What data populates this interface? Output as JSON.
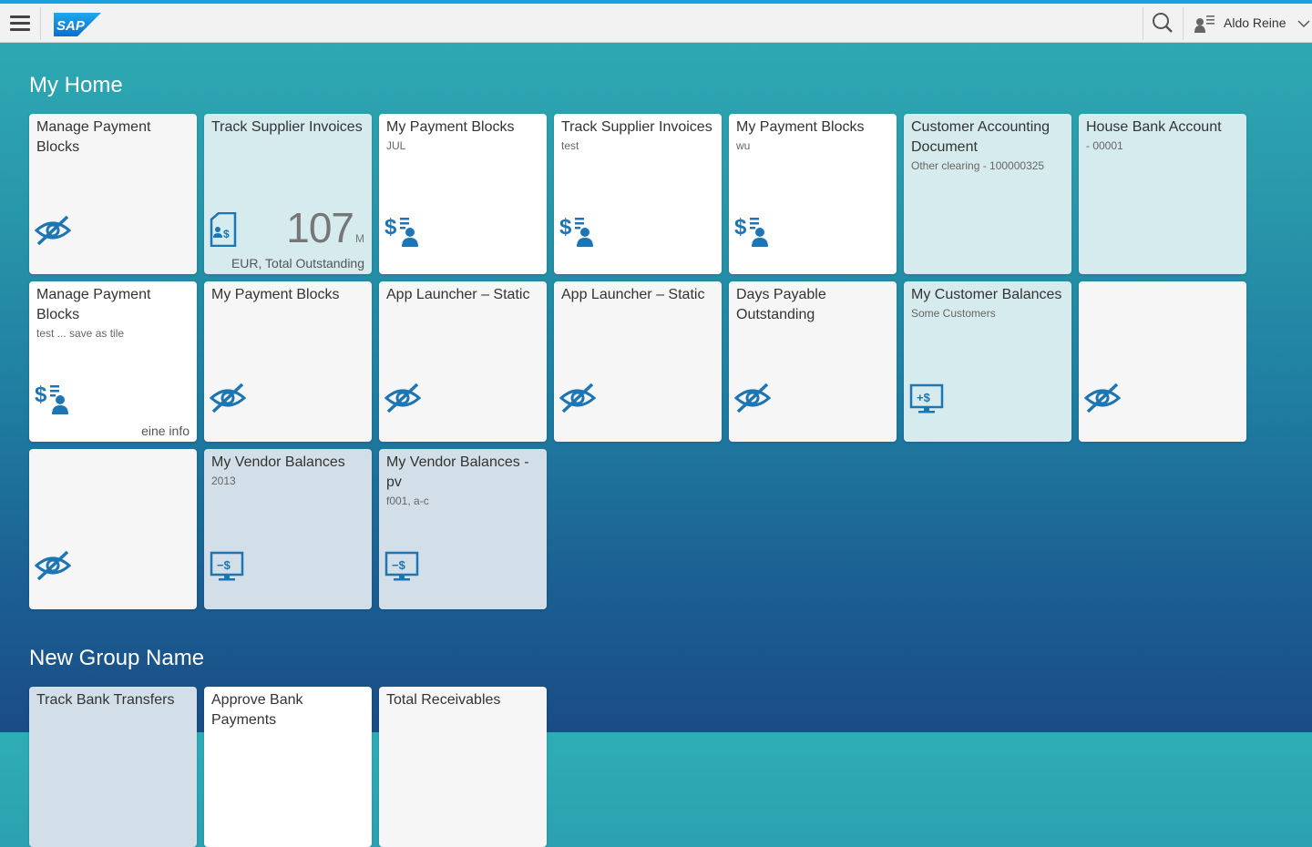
{
  "shell": {
    "logo_text": "SAP",
    "user_name": "Aldo Reine"
  },
  "groups": [
    {
      "title": "My Home",
      "tiles": [
        {
          "title": "Manage Payment Blocks",
          "subtitle": "",
          "icon": "hidden-eye-icon"
        },
        {
          "title": "Track Supplier Invoices",
          "subtitle": "",
          "icon": "invoice-icon",
          "kpi_value": "107",
          "kpi_scale": "M",
          "footer": "EUR, Total Outstanding"
        },
        {
          "title": "My Payment Blocks",
          "subtitle": "JUL",
          "icon": "payment-person-icon"
        },
        {
          "title": "Track Supplier Invoices",
          "subtitle": "test",
          "icon": "payment-person-icon"
        },
        {
          "title": "My Payment Blocks",
          "subtitle": "wu",
          "icon": "payment-person-icon"
        },
        {
          "title": "Customer Accounting Document",
          "subtitle": "Other clearing - 100000325",
          "icon": ""
        },
        {
          "title": "House Bank Account",
          "subtitle": "- 00001",
          "icon": ""
        },
        {
          "title": "Manage Payment Blocks",
          "subtitle": "test ... save as tile",
          "icon": "payment-person-icon",
          "footer": "eine info"
        },
        {
          "title": "My Payment Blocks",
          "subtitle": "",
          "icon": "hidden-eye-icon"
        },
        {
          "title": "App Launcher – Static",
          "subtitle": "",
          "icon": "hidden-eye-icon"
        },
        {
          "title": "App Launcher – Static",
          "subtitle": "",
          "icon": "hidden-eye-icon"
        },
        {
          "title": "Days Payable Outstanding",
          "subtitle": "",
          "icon": "hidden-eye-icon"
        },
        {
          "title": "My Customer Balances",
          "subtitle": "Some Customers",
          "icon": "monitor-plus-dollar-icon",
          "icon_text": "+$"
        },
        {
          "title": "",
          "subtitle": "",
          "icon": "hidden-eye-icon"
        },
        {
          "title": "",
          "subtitle": "",
          "icon": "hidden-eye-icon"
        },
        {
          "title": "My Vendor Balances",
          "subtitle": "2013",
          "icon": "monitor-minus-dollar-icon",
          "icon_text": "−$"
        },
        {
          "title": "My Vendor Balances - pv",
          "subtitle": "f001, a-c",
          "icon": "monitor-minus-dollar-icon",
          "icon_text": "−$"
        }
      ]
    },
    {
      "title": "New Group Name",
      "tiles": [
        {
          "title": "Track Bank Transfers",
          "subtitle": ""
        },
        {
          "title": "Approve Bank Payments",
          "subtitle": ""
        },
        {
          "title": "Total Receivables",
          "subtitle": ""
        }
      ]
    }
  ]
}
